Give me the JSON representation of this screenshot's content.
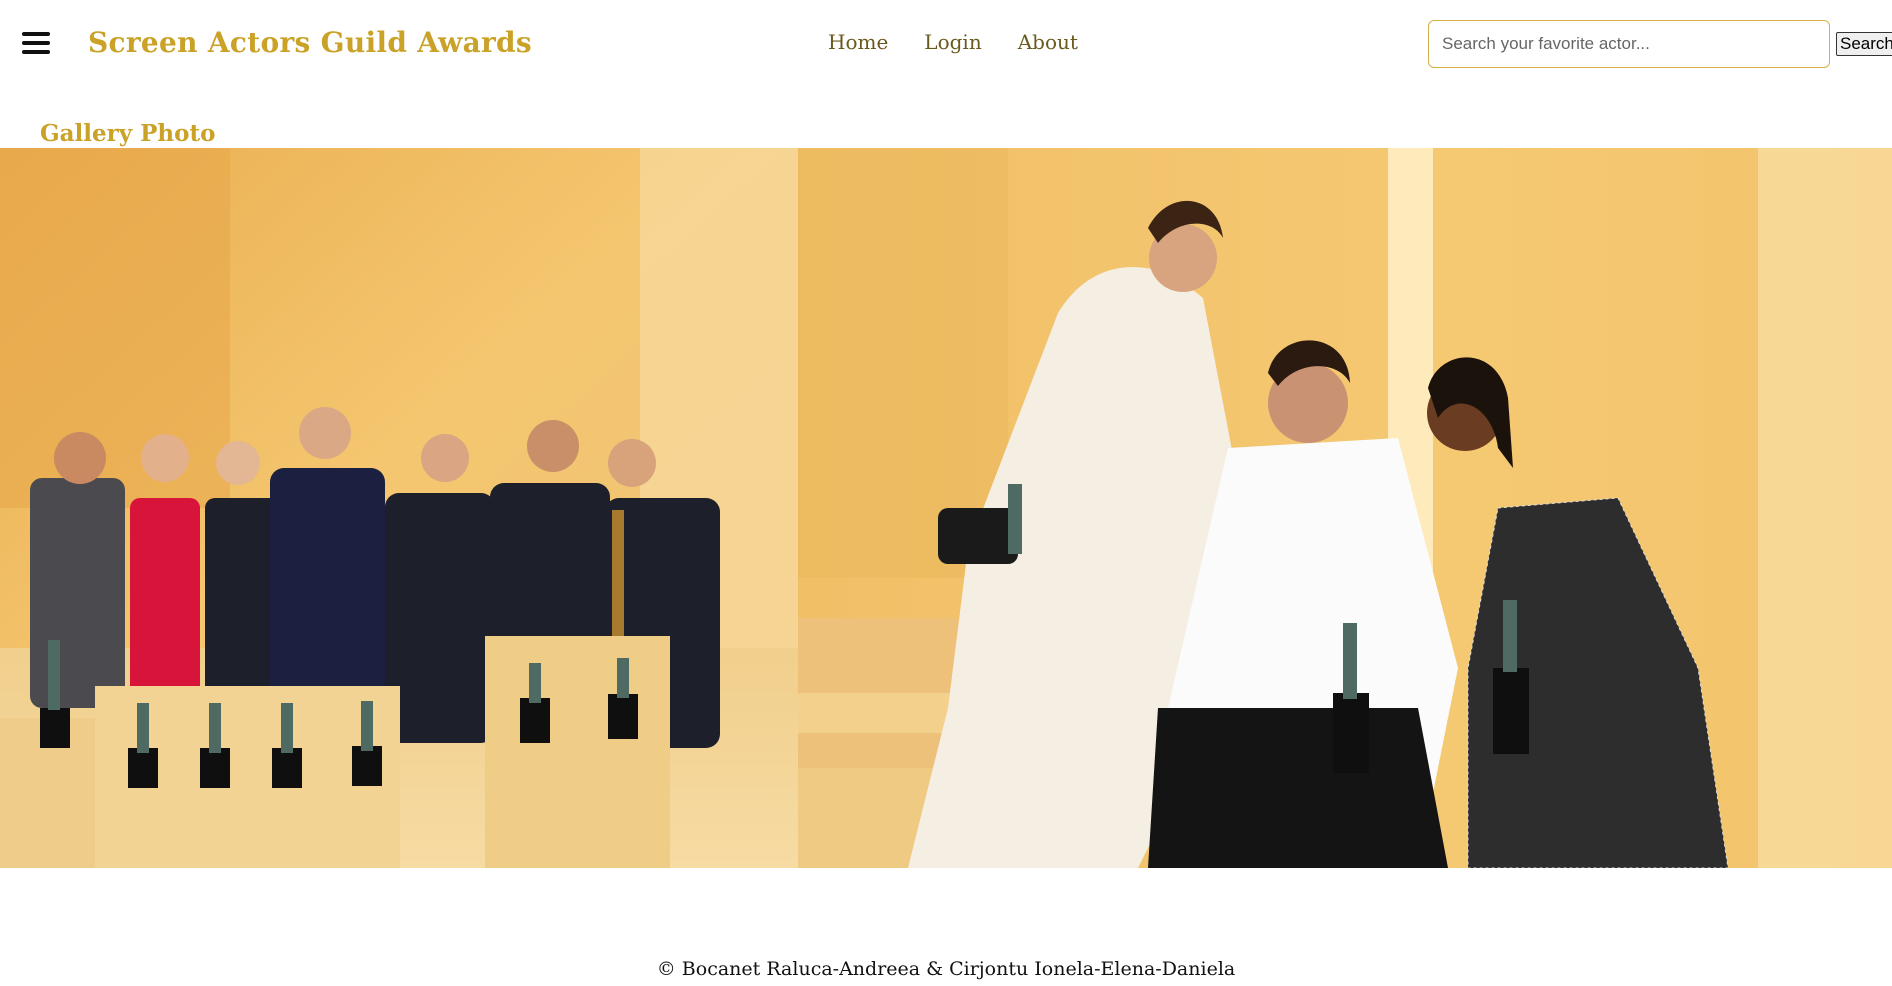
{
  "header": {
    "menu_icon": "hamburger-menu-icon",
    "brand": "Screen Actors Guild Awards",
    "nav": [
      {
        "label": "Home"
      },
      {
        "label": "Login"
      },
      {
        "label": "About"
      }
    ],
    "search": {
      "placeholder": "Search your favorite actor...",
      "value": "",
      "button_label": "Search"
    }
  },
  "gallery": {
    "title": "Gallery Photo",
    "photos": [
      {
        "id": "group-photo"
      },
      {
        "id": "trio-photo"
      }
    ]
  },
  "footer": {
    "text": "© Bocanet Raluca-Andreea & Cirjontu Ionela-Elena-Daniela"
  },
  "colors": {
    "brand": "#c9a227",
    "nav": "#6b5a1e",
    "backdrop": "#f2c56a"
  }
}
